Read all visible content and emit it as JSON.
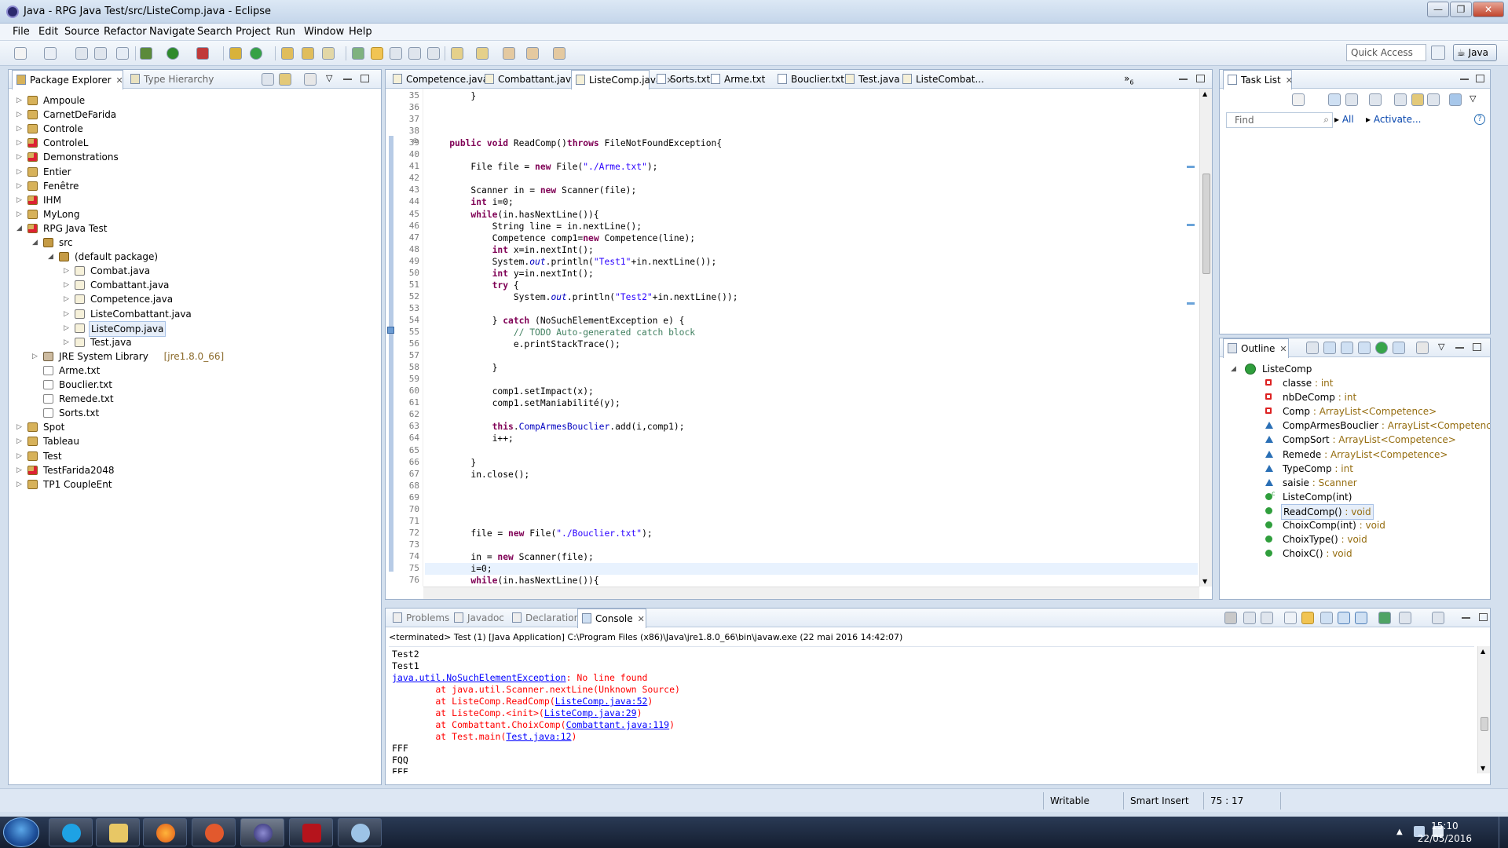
{
  "window": {
    "title": "Java - RPG Java Test/src/ListeComp.java - Eclipse",
    "controls": {
      "minimize": "—",
      "restore": "❐",
      "close": "✕"
    }
  },
  "menu": [
    "File",
    "Edit",
    "Source",
    "Refactor",
    "Navigate",
    "Search",
    "Project",
    "Run",
    "Window",
    "Help"
  ],
  "toolbar": {
    "quick_access": "Quick Access",
    "perspective": "Java"
  },
  "package_explorer": {
    "tab_label": "Package Explorer",
    "tab2_label": "Type Hierarchy",
    "items": [
      {
        "label": "Ampoule",
        "level": 0,
        "icon": "project-icon",
        "expand": "collapsed"
      },
      {
        "label": "CarnetDeFarida",
        "level": 0,
        "icon": "project-icon",
        "expand": "collapsed"
      },
      {
        "label": "Controle",
        "level": 0,
        "icon": "project-icon",
        "expand": "collapsed"
      },
      {
        "label": "ControleL",
        "level": 0,
        "icon": "project-error-icon",
        "expand": "collapsed"
      },
      {
        "label": "Demonstrations",
        "level": 0,
        "icon": "project-error-icon",
        "expand": "collapsed"
      },
      {
        "label": "Entier",
        "level": 0,
        "icon": "project-icon",
        "expand": "collapsed"
      },
      {
        "label": "Fenêtre",
        "level": 0,
        "icon": "project-icon",
        "expand": "collapsed"
      },
      {
        "label": "IHM",
        "level": 0,
        "icon": "project-error-icon",
        "expand": "collapsed"
      },
      {
        "label": "MyLong",
        "level": 0,
        "icon": "project-icon",
        "expand": "collapsed"
      },
      {
        "label": "RPG Java Test",
        "level": 0,
        "icon": "project-error-icon",
        "expand": "expanded"
      },
      {
        "label": "src",
        "level": 1,
        "icon": "source-folder-icon",
        "expand": "expanded"
      },
      {
        "label": "(default package)",
        "level": 2,
        "icon": "package-icon",
        "expand": "expanded"
      },
      {
        "label": "Combat.java",
        "level": 3,
        "icon": "java-file-icon",
        "expand": "collapsed"
      },
      {
        "label": "Combattant.java",
        "level": 3,
        "icon": "java-file-icon",
        "expand": "collapsed"
      },
      {
        "label": "Competence.java",
        "level": 3,
        "icon": "java-file-icon",
        "expand": "collapsed"
      },
      {
        "label": "ListeCombattant.java",
        "level": 3,
        "icon": "java-file-icon",
        "expand": "collapsed"
      },
      {
        "label": "ListeComp.java",
        "level": 3,
        "icon": "java-file-icon",
        "expand": "collapsed",
        "selected": true
      },
      {
        "label": "Test.java",
        "level": 3,
        "icon": "java-file-icon",
        "expand": "collapsed"
      },
      {
        "label": "JRE System Library",
        "suffix": "[jre1.8.0_66]",
        "level": 1,
        "icon": "library-icon",
        "expand": "collapsed"
      },
      {
        "label": "Arme.txt",
        "level": 1,
        "icon": "text-file-icon",
        "expand": "none"
      },
      {
        "label": "Bouclier.txt",
        "level": 1,
        "icon": "text-file-icon",
        "expand": "none"
      },
      {
        "label": "Remede.txt",
        "level": 1,
        "icon": "text-file-icon",
        "expand": "none"
      },
      {
        "label": "Sorts.txt",
        "level": 1,
        "icon": "text-file-icon",
        "expand": "none"
      },
      {
        "label": "Spot",
        "level": 0,
        "icon": "project-icon",
        "expand": "collapsed"
      },
      {
        "label": "Tableau",
        "level": 0,
        "icon": "project-icon",
        "expand": "collapsed"
      },
      {
        "label": "Test",
        "level": 0,
        "icon": "project-icon",
        "expand": "collapsed"
      },
      {
        "label": "TestFarida2048",
        "level": 0,
        "icon": "project-error-icon",
        "expand": "collapsed"
      },
      {
        "label": "TP1 CoupleEnt",
        "level": 0,
        "icon": "project-icon",
        "expand": "collapsed"
      }
    ]
  },
  "editor": {
    "tabs": [
      {
        "label": "Competence.java",
        "icon": "java-file-icon"
      },
      {
        "label": "Combattant.java",
        "icon": "java-file-icon"
      },
      {
        "label": "ListeComp.java",
        "icon": "java-file-icon",
        "active": true
      },
      {
        "label": "Sorts.txt",
        "icon": "text-file-icon"
      },
      {
        "label": "Arme.txt",
        "icon": "text-file-icon"
      },
      {
        "label": "Bouclier.txt",
        "icon": "text-file-icon"
      },
      {
        "label": "Test.java",
        "icon": "java-file-icon"
      },
      {
        "label": "ListeCombat...",
        "icon": "java-file-icon"
      }
    ],
    "overflow_label": "»",
    "overflow_count": "6",
    "lines": [
      {
        "n": "35",
        "t": [
          [
            "plain",
            "        }"
          ]
        ]
      },
      {
        "n": "36",
        "t": []
      },
      {
        "n": "37",
        "t": []
      },
      {
        "n": "38",
        "t": []
      },
      {
        "n": "39",
        "t": [
          [
            "plain",
            "    "
          ],
          [
            "kw",
            "public"
          ],
          [
            "plain",
            " "
          ],
          [
            "kw",
            "void"
          ],
          [
            "plain",
            " ReadComp()"
          ],
          [
            "kw",
            "throws"
          ],
          [
            "plain",
            " FileNotFoundException{"
          ]
        ]
      },
      {
        "n": "40",
        "t": []
      },
      {
        "n": "41",
        "t": [
          [
            "plain",
            "        File file = "
          ],
          [
            "kw",
            "new"
          ],
          [
            "plain",
            " File("
          ],
          [
            "str",
            "\"./Arme.txt\""
          ],
          [
            "plain",
            ");"
          ]
        ]
      },
      {
        "n": "42",
        "t": []
      },
      {
        "n": "43",
        "t": [
          [
            "plain",
            "        Scanner in = "
          ],
          [
            "kw",
            "new"
          ],
          [
            "plain",
            " Scanner(file);"
          ]
        ]
      },
      {
        "n": "44",
        "t": [
          [
            "plain",
            "        "
          ],
          [
            "kw",
            "int"
          ],
          [
            "plain",
            " i=0;"
          ]
        ]
      },
      {
        "n": "45",
        "t": [
          [
            "plain",
            "        "
          ],
          [
            "kw",
            "while"
          ],
          [
            "plain",
            "(in.hasNextLine()){"
          ]
        ]
      },
      {
        "n": "46",
        "t": [
          [
            "plain",
            "            String line = in.nextLine();"
          ]
        ]
      },
      {
        "n": "47",
        "t": [
          [
            "plain",
            "            Competence comp1="
          ],
          [
            "kw",
            "new"
          ],
          [
            "plain",
            " Competence(line);"
          ]
        ]
      },
      {
        "n": "48",
        "t": [
          [
            "plain",
            "            "
          ],
          [
            "kw",
            "int"
          ],
          [
            "plain",
            " x=in.nextInt();"
          ]
        ]
      },
      {
        "n": "49",
        "t": [
          [
            "plain",
            "            System."
          ],
          [
            "fdi",
            "out"
          ],
          [
            "plain",
            ".println("
          ],
          [
            "str",
            "\"Test1\""
          ],
          [
            "plain",
            "+in.nextLine());"
          ]
        ]
      },
      {
        "n": "50",
        "t": [
          [
            "plain",
            "            "
          ],
          [
            "kw",
            "int"
          ],
          [
            "plain",
            " y=in.nextInt();"
          ]
        ]
      },
      {
        "n": "51",
        "t": [
          [
            "plain",
            "            "
          ],
          [
            "kw",
            "try"
          ],
          [
            "plain",
            " {"
          ]
        ]
      },
      {
        "n": "52",
        "t": [
          [
            "plain",
            "                System."
          ],
          [
            "fdi",
            "out"
          ],
          [
            "plain",
            ".println("
          ],
          [
            "str",
            "\"Test2\""
          ],
          [
            "plain",
            "+in.nextLine());"
          ]
        ]
      },
      {
        "n": "53",
        "t": []
      },
      {
        "n": "54",
        "t": [
          [
            "plain",
            "            } "
          ],
          [
            "kw",
            "catch"
          ],
          [
            "plain",
            " (NoSuchElementException e) {"
          ]
        ]
      },
      {
        "n": "55",
        "t": [
          [
            "plain",
            "                "
          ],
          [
            "cm",
            "// TODO Auto-generated catch block"
          ]
        ]
      },
      {
        "n": "56",
        "t": [
          [
            "plain",
            "                e.printStackTrace();"
          ]
        ]
      },
      {
        "n": "57",
        "t": []
      },
      {
        "n": "58",
        "t": [
          [
            "plain",
            "            }"
          ]
        ]
      },
      {
        "n": "59",
        "t": []
      },
      {
        "n": "60",
        "t": [
          [
            "plain",
            "            comp1.setImpact(x);"
          ]
        ]
      },
      {
        "n": "61",
        "t": [
          [
            "plain",
            "            comp1.setManiabilité(y);"
          ]
        ]
      },
      {
        "n": "62",
        "t": []
      },
      {
        "n": "63",
        "t": [
          [
            "plain",
            "            "
          ],
          [
            "kw",
            "this"
          ],
          [
            "plain",
            "."
          ],
          [
            "fd",
            "CompArmesBouclier"
          ],
          [
            "plain",
            ".add(i,comp1);"
          ]
        ]
      },
      {
        "n": "64",
        "t": [
          [
            "plain",
            "            i++;"
          ]
        ]
      },
      {
        "n": "65",
        "t": []
      },
      {
        "n": "66",
        "t": [
          [
            "plain",
            "        }"
          ]
        ]
      },
      {
        "n": "67",
        "t": [
          [
            "plain",
            "        in.close();"
          ]
        ]
      },
      {
        "n": "68",
        "t": []
      },
      {
        "n": "69",
        "t": []
      },
      {
        "n": "70",
        "t": []
      },
      {
        "n": "71",
        "t": []
      },
      {
        "n": "72",
        "t": [
          [
            "plain",
            "        file = "
          ],
          [
            "kw",
            "new"
          ],
          [
            "plain",
            " File("
          ],
          [
            "str",
            "\"./Bouclier.txt\""
          ],
          [
            "plain",
            ");"
          ]
        ]
      },
      {
        "n": "73",
        "t": []
      },
      {
        "n": "74",
        "t": [
          [
            "plain",
            "        in = "
          ],
          [
            "kw",
            "new"
          ],
          [
            "plain",
            " Scanner(file);"
          ]
        ]
      },
      {
        "n": "75",
        "t": [
          [
            "plain",
            "        i=0;"
          ]
        ],
        "current": true
      },
      {
        "n": "76",
        "t": [
          [
            "plain",
            "        "
          ],
          [
            "kw",
            "while"
          ],
          [
            "plain",
            "(in.hasNextLine()){"
          ]
        ]
      }
    ]
  },
  "task_list": {
    "tab_label": "Task List",
    "find_placeholder": "Find",
    "all_label": "All",
    "activate_label": "Activate...",
    "help": "?"
  },
  "outline": {
    "tab_label": "Outline",
    "root": "ListeComp",
    "members": [
      {
        "name": "classe",
        "type": ": int",
        "icon": "private-field-icon"
      },
      {
        "name": "nbDeComp",
        "type": ": int",
        "icon": "private-field-icon"
      },
      {
        "name": "Comp",
        "type": ": ArrayList<Competence>",
        "icon": "private-field-icon"
      },
      {
        "name": "CompArmesBouclier",
        "type": ": ArrayList<Competence>",
        "icon": "package-field-icon"
      },
      {
        "name": "CompSort",
        "type": ": ArrayList<Competence>",
        "icon": "package-field-icon"
      },
      {
        "name": "Remede",
        "type": ": ArrayList<Competence>",
        "icon": "package-field-icon"
      },
      {
        "name": "TypeComp",
        "type": ": int",
        "icon": "package-field-icon"
      },
      {
        "name": "saisie",
        "type": ": Scanner",
        "icon": "package-field-icon"
      },
      {
        "name": "ListeComp(int)",
        "type": "",
        "icon": "constructor-icon"
      },
      {
        "name": "ReadComp()",
        "type": ": void",
        "icon": "public-method-icon",
        "selected": true
      },
      {
        "name": "ChoixComp(int)",
        "type": ": void",
        "icon": "public-method-icon"
      },
      {
        "name": "ChoixType()",
        "type": ": void",
        "icon": "public-method-icon"
      },
      {
        "name": "ChoixC()",
        "type": ": void",
        "icon": "public-method-icon"
      }
    ]
  },
  "console": {
    "tabs": [
      {
        "label": "Problems",
        "icon": "problems-icon"
      },
      {
        "label": "Javadoc",
        "icon": "javadoc-icon"
      },
      {
        "label": "Declaration",
        "icon": "declaration-icon"
      },
      {
        "label": "Console",
        "icon": "console-icon",
        "active": true
      }
    ],
    "info": "<terminated> Test (1) [Java Application] C:\\Program Files (x86)\\Java\\jre1.8.0_66\\bin\\javaw.exe (22 mai 2016 14:42:07)",
    "lines": [
      [
        [
          "plain",
          "Test2"
        ]
      ],
      [
        [
          "plain",
          "Test1"
        ]
      ],
      [
        [
          "lnk",
          "java.util.NoSuchElementException"
        ],
        [
          "err",
          ": No line found"
        ]
      ],
      [
        [
          "err",
          "        at java.util.Scanner.nextLine(Unknown Source)"
        ]
      ],
      [
        [
          "err",
          "        at ListeComp.ReadComp("
        ],
        [
          "lnk",
          "ListeComp.java:52"
        ],
        [
          "err",
          ")"
        ]
      ],
      [
        [
          "err",
          "        at ListeComp.<init>("
        ],
        [
          "lnk",
          "ListeComp.java:29"
        ],
        [
          "err",
          ")"
        ]
      ],
      [
        [
          "err",
          "        at Combattant.ChoixComp("
        ],
        [
          "lnk",
          "Combattant.java:119"
        ],
        [
          "err",
          ")"
        ]
      ],
      [
        [
          "err",
          "        at Test.main("
        ],
        [
          "lnk",
          "Test.java:12"
        ],
        [
          "err",
          ")"
        ]
      ],
      [
        [
          "plain",
          "FFF"
        ]
      ],
      [
        [
          "plain",
          "FQQ"
        ]
      ],
      [
        [
          "plain",
          "FFF"
        ]
      ]
    ]
  },
  "status": {
    "writable": "Writable",
    "insert": "Smart Insert",
    "position": "75 : 17"
  },
  "taskbar": {
    "time": "15:10",
    "date": "22/05/2016"
  },
  "colors": {
    "keyword": "#7f0055",
    "string": "#2a00ff",
    "comment": "#3f7f5f",
    "field": "#0000c0",
    "error": "#ff0000"
  }
}
